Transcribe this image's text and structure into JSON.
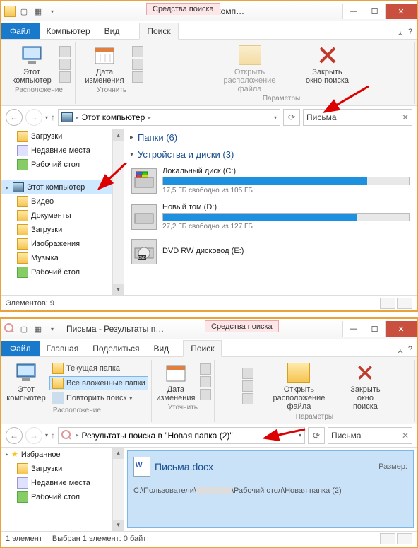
{
  "w1": {
    "search_tools": "Средства поиска",
    "title": "Письма - Этот комп…",
    "tabs": {
      "file": "Файл",
      "computer": "Компьютер",
      "view": "Вид",
      "search": "Поиск"
    },
    "ribbon": {
      "this_computer": "Этот\nкомпьютер",
      "date": "Дата\nизменения",
      "open_location": "Открыть\nрасположение файла",
      "close_search": "Закрыть\nокно поиска",
      "g_location": "Расположение",
      "g_refine": "Уточнить",
      "g_params": "Параметры"
    },
    "breadcrumb": "Этот компьютер",
    "search_value": "Письма",
    "tree": {
      "downloads": "Загрузки",
      "recent": "Недавние места",
      "desktop": "Рабочий стол",
      "this_pc": "Этот компьютер",
      "videos": "Видео",
      "documents": "Документы",
      "downloads2": "Загрузки",
      "pictures": "Изображения",
      "music": "Музыка",
      "desktop2": "Рабочий стол"
    },
    "folders_header": "Папки (6)",
    "devices_header": "Устройства и диски (3)",
    "drives": [
      {
        "name": "Локальный диск (C:)",
        "free": "17,5 ГБ свободно из 105 ГБ",
        "pct": 83
      },
      {
        "name": "Новый том (D:)",
        "free": "27,2 ГБ свободно из 127 ГБ",
        "pct": 79
      }
    ],
    "dvd": "DVD RW дисковод (E:)",
    "status": "Элементов: 9"
  },
  "w2": {
    "title": "Письма - Результаты п…",
    "search_tools": "Средства поиска",
    "tabs": {
      "file": "Файл",
      "home": "Главная",
      "share": "Поделиться",
      "view": "Вид",
      "search": "Поиск"
    },
    "ribbon": {
      "this_computer": "Этот\nкомпьютер",
      "current_folder": "Текущая папка",
      "all_subfolders": "Все вложенные папки",
      "search_again": "Повторить поиск",
      "date": "Дата\nизменения",
      "open_location": "Открыть\nрасположение файла",
      "close_search": "Закрыть\nокно поиска",
      "g_location": "Расположение",
      "g_refine": "Уточнить",
      "g_params": "Параметры"
    },
    "breadcrumb": "Результаты поиска в \"Новая папка (2)\"",
    "search_value": "Письма",
    "tree": {
      "favorites": "Избранное",
      "downloads": "Загрузки",
      "recent": "Недавние места",
      "desktop": "Рабочий стол"
    },
    "result": {
      "name": "Письма.docx",
      "size_label": "Размер:",
      "path_prefix": "C:\\Пользователи\\",
      "path_suffix": "\\Рабочий стол\\Новая папка (2)"
    },
    "status_left": "1 элемент",
    "status_sel": "Выбран 1 элемент: 0 байт"
  }
}
